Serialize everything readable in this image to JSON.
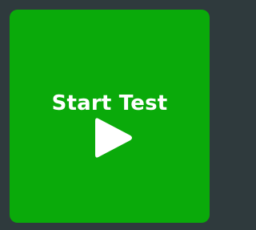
{
  "start_tile": {
    "label": "Start Test",
    "icon": "play-icon",
    "colors": {
      "background": "#0aaa0a",
      "text": "#ffffff",
      "icon": "#ffffff",
      "frame": "#2f3a3d"
    }
  }
}
